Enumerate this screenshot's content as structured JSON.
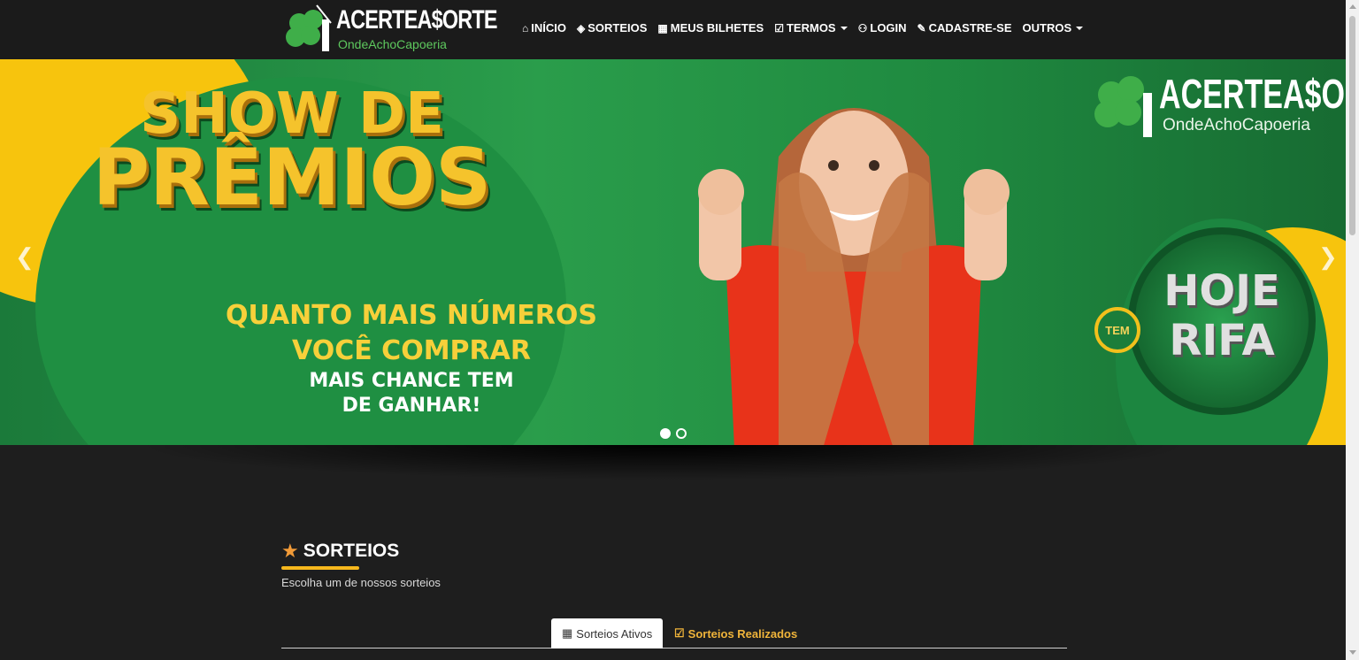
{
  "brand": {
    "name": "ACERTEA$ORTE",
    "tagline": "OndeAchoCapoeria"
  },
  "nav": {
    "items": [
      {
        "label": "INÍCIO",
        "icon": "home-icon"
      },
      {
        "label": "SORTEIOS",
        "icon": "ticket-icon"
      },
      {
        "label": "MEUS BILHETES",
        "icon": "grid-icon"
      },
      {
        "label": "TERMOS",
        "icon": "check-square-icon",
        "dropdown": true
      },
      {
        "label": "LOGIN",
        "icon": "user-icon"
      },
      {
        "label": "CADASTRE-SE",
        "icon": "edit-icon"
      },
      {
        "label": "OUTROS",
        "dropdown": true
      }
    ]
  },
  "banner": {
    "headline_1": "SHOW DE",
    "headline_2": "PRÊMIOS",
    "promo_1": "QUANTO MAIS NÚMEROS",
    "promo_2": "VOCÊ COMPRAR",
    "promo_3": "MAIS CHANCE TEM",
    "promo_4": "DE GANHAR!",
    "badge_small": "TEM",
    "badge_1": "HOJE",
    "badge_2": "RIFA",
    "logo_title": "ACERTEA$ORTE",
    "logo_sub": "OndeAchoCapoeria",
    "slides": 2,
    "active_slide": 1
  },
  "section": {
    "title": "SORTEIOS",
    "subtitle": "Escolha um de nossos sorteios",
    "tabs": [
      {
        "label": "Sorteios Ativos",
        "icon": "grid-icon",
        "active": true
      },
      {
        "label": "Sorteios Realizados",
        "icon": "check-square-icon",
        "active": false
      }
    ]
  },
  "colors": {
    "accent": "#f7b81d",
    "brand_green": "#2a9d4b",
    "nav_bg": "#1b1b1b",
    "page_bg": "#1e1e1e"
  }
}
